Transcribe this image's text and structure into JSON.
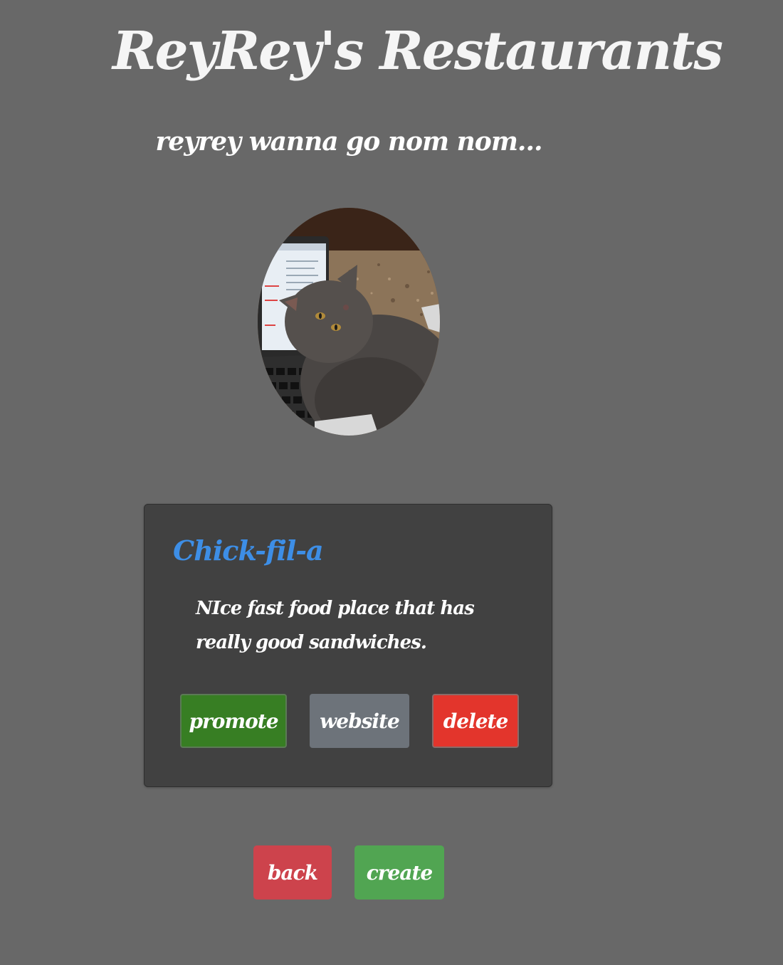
{
  "header": {
    "title": "ReyRey's Restaurants",
    "tagline": "reyrey wanna go nom nom..."
  },
  "avatar": {
    "icon": "cat-photo"
  },
  "restaurant_card": {
    "name": "Chick-fil-a",
    "description": "NIce fast food place that has really good sandwiches.",
    "buttons": {
      "promote": "promote",
      "website": "website",
      "delete": "delete"
    }
  },
  "footer_buttons": {
    "back": "back",
    "create": "create"
  },
  "colors": {
    "background": "#686868",
    "card": "#414141",
    "restaurant_name": "#3d8ee6",
    "promote": "#377e23",
    "website": "#6d737a",
    "delete": "#e3352c",
    "back": "#cd434c",
    "create": "#51a552"
  }
}
